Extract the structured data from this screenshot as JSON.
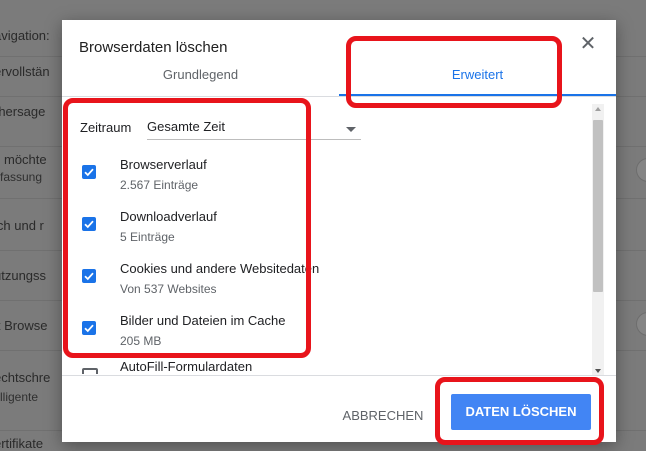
{
  "background": {
    "rows": [
      {
        "text": "avigation:"
      },
      {
        "text": "ervollstän"
      },
      {
        "text": "rhersage"
      },
      {
        "text": "möchte",
        "sub": "fassung"
      },
      {
        "text": "ich und r"
      },
      {
        "text": "utzungss"
      },
      {
        "text": "lt Browse"
      },
      {
        "text": "echtschre",
        "sub": "lligente"
      },
      {
        "text": "ertifikate"
      }
    ]
  },
  "dialog": {
    "title": "Browserdaten löschen",
    "close_glyph": "✕",
    "tabs": [
      {
        "label": "Grundlegend",
        "active": false
      },
      {
        "label": "Erweitert",
        "active": true
      }
    ],
    "timerange": {
      "label": "Zeitraum",
      "value": "Gesamte Zeit"
    },
    "items": [
      {
        "title": "Browserverlauf",
        "subtitle": "2.567 Einträge",
        "checked": true
      },
      {
        "title": "Downloadverlauf",
        "subtitle": "5 Einträge",
        "checked": true
      },
      {
        "title": "Cookies und andere Websitedaten",
        "subtitle": "Von 537 Websites",
        "checked": true
      },
      {
        "title": "Bilder und Dateien im Cache",
        "subtitle": "205 MB",
        "checked": true
      },
      {
        "title": "AutoFill-Formulardaten",
        "subtitle": "",
        "checked": false
      }
    ],
    "buttons": {
      "cancel": "ABBRECHEN",
      "delete": "DATEN LÖSCHEN"
    }
  },
  "colors": {
    "accent": "#1a73e8",
    "primary_button": "#4285f4",
    "highlight": "#e8141b",
    "overlay": "#7b7b7b"
  },
  "icons": {
    "checkmark": "check-icon",
    "close": "close-icon",
    "dropdown": "dropdown-arrow-icon"
  }
}
